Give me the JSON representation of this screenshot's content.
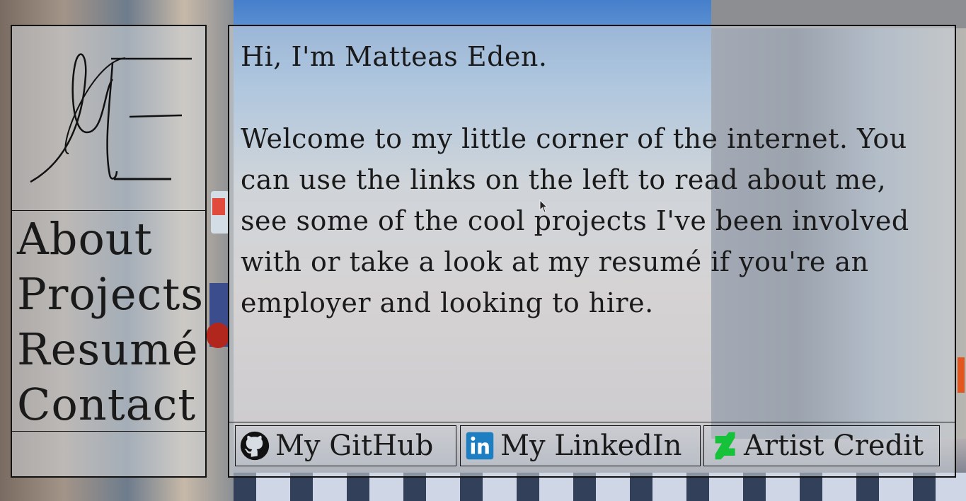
{
  "colors": {
    "panel_border": "#111111",
    "linkedin": "#1d7ec1",
    "artist_icon": "#17c23b"
  },
  "sidebar": {
    "logo_icon": "me-monogram-logo",
    "nav": [
      {
        "label": "About"
      },
      {
        "label": "Projects"
      },
      {
        "label": "Resumé"
      },
      {
        "label": "Contact"
      }
    ]
  },
  "main": {
    "greeting": "Hi, I'm Matteas Eden.",
    "intro": "Welcome to my little corner of the internet. You can use the links on the left to read about me, see some of the cool projects I've been involved with or take a look at my resumé if you're an employer and looking to hire."
  },
  "footer_links": {
    "github": {
      "label": "My GitHub",
      "icon": "github-icon"
    },
    "linkedin": {
      "label": "My LinkedIn",
      "icon": "linkedin-icon"
    },
    "artist": {
      "label": "Artist Credit",
      "icon": "deviantart-icon"
    }
  }
}
